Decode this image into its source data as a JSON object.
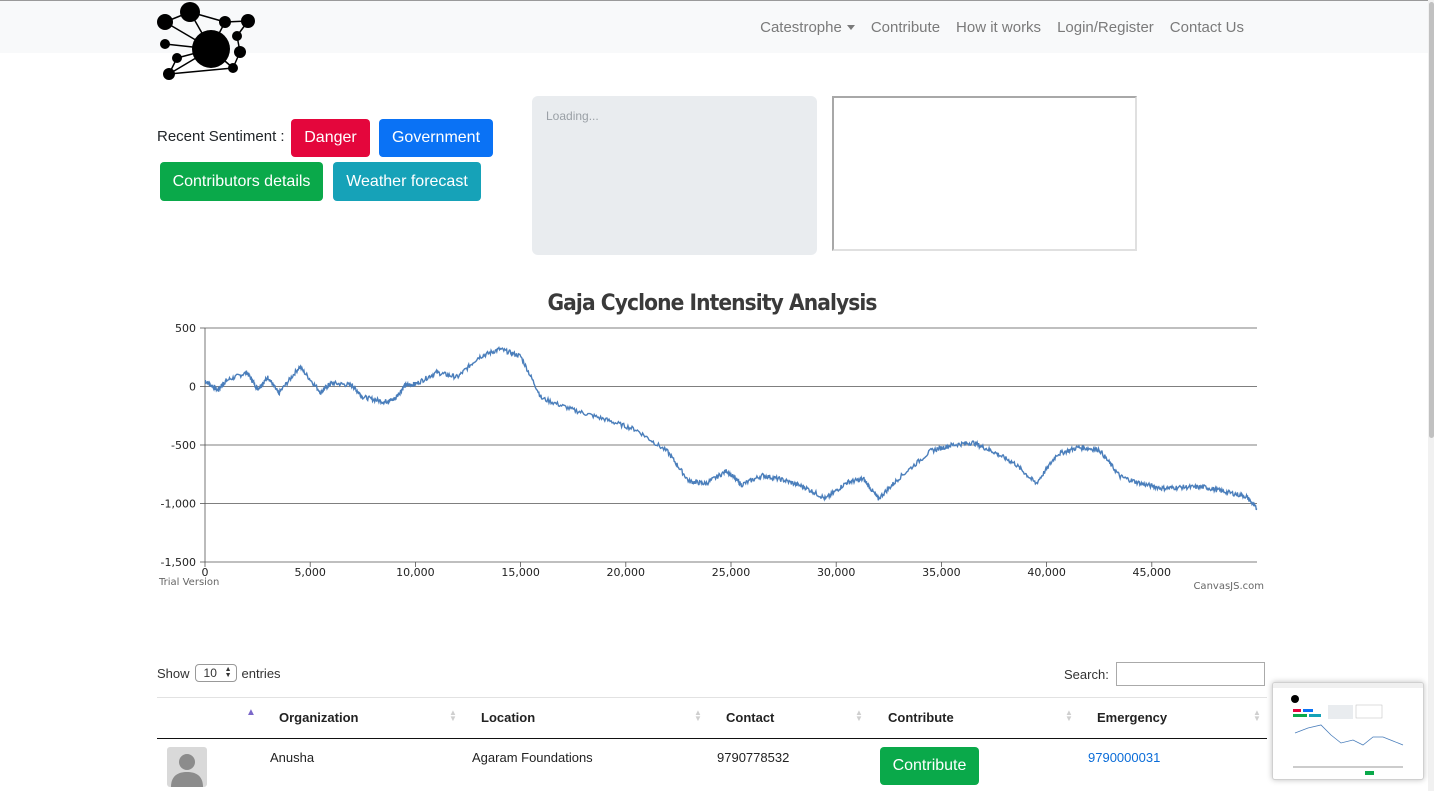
{
  "nav": {
    "items": [
      "Catestrophe",
      "Contribute",
      "How it works",
      "Login/Register",
      "Contact Us"
    ]
  },
  "sentiment": {
    "label": "Recent Sentiment :",
    "buttons": {
      "danger": "Danger",
      "government": "Government",
      "contributors": "Contributors details",
      "weather": "Weather forecast"
    }
  },
  "loading_text": "Loading...",
  "colors": {
    "danger": "#e4063c",
    "primary": "#0a72f5",
    "success": "#0aa94a",
    "info": "#16a2b8",
    "series_line": "#4a7ebb"
  },
  "chart_data": {
    "type": "line",
    "title": "Gaja Cyclone Intensity Analysis",
    "xlabel": "",
    "ylabel": "",
    "xlim": [
      0,
      50000
    ],
    "ylim": [
      -1500,
      500
    ],
    "x_ticks": [
      "0",
      "5,000",
      "10,000",
      "15,000",
      "20,000",
      "25,000",
      "30,000",
      "35,000",
      "40,000",
      "45,000"
    ],
    "y_ticks": [
      "500",
      "0",
      "-500",
      "-1,000",
      "-1,500"
    ],
    "grid": "horizontal",
    "credit_left": "Trial Version",
    "credit_right": "CanvasJS.com",
    "x": [
      0,
      600,
      1000,
      2000,
      2500,
      3000,
      3500,
      4500,
      5500,
      6000,
      7000,
      7500,
      8500,
      9000,
      9500,
      10000,
      11000,
      12000,
      13000,
      14000,
      15000,
      16000,
      17500,
      19000,
      20500,
      22000,
      23000,
      23800,
      24800,
      25500,
      26500,
      27500,
      28500,
      29500,
      30500,
      31300,
      32000,
      33000,
      34500,
      35500,
      36500,
      37500,
      38500,
      39500,
      40500,
      41500,
      42500,
      43500,
      44500,
      45500,
      46500,
      47500,
      48500,
      49500,
      50000
    ],
    "y": [
      50,
      -30,
      50,
      120,
      -20,
      80,
      -60,
      170,
      -50,
      30,
      10,
      -90,
      -130,
      -110,
      10,
      20,
      120,
      80,
      250,
      320,
      260,
      -100,
      -200,
      -280,
      -370,
      -560,
      -810,
      -830,
      -720,
      -840,
      -760,
      -800,
      -860,
      -960,
      -820,
      -790,
      -960,
      -780,
      -550,
      -500,
      -480,
      -560,
      -660,
      -830,
      -580,
      -520,
      -540,
      -770,
      -830,
      -870,
      -860,
      -860,
      -900,
      -940,
      -1050
    ]
  },
  "table": {
    "show_label": "Show",
    "entries_value": "10",
    "entries_label": "entries",
    "search_label": "Search:",
    "columns": [
      "Organization",
      "Location",
      "Contact",
      "Contribute",
      "Emergency"
    ],
    "rows": [
      {
        "organization": "Anusha",
        "location": "Agaram Foundations",
        "contact": "9790778532",
        "contribute_label": "Contribute",
        "emergency": "9790000031"
      }
    ]
  }
}
